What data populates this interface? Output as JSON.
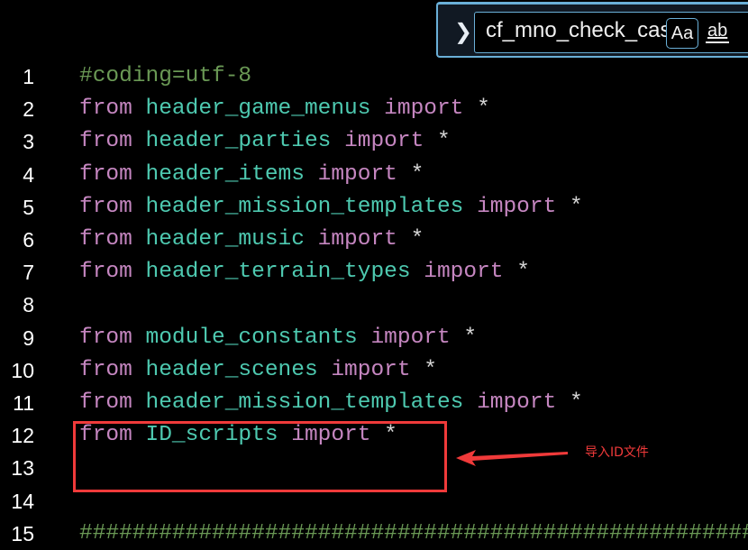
{
  "find_widget": {
    "query": "cf_mno_check_cas",
    "match_case_label": "Aa",
    "whole_word_label": "ab",
    "expand_icon": "chevron-right-icon"
  },
  "lines": [
    {
      "n": "1",
      "tokens": [
        [
          "cm",
          "#coding=utf-8"
        ]
      ]
    },
    {
      "n": "2",
      "tokens": [
        [
          "kw",
          "from"
        ],
        [
          "op",
          " "
        ],
        [
          "id",
          "header_game_menus"
        ],
        [
          "op",
          " "
        ],
        [
          "kw",
          "import"
        ],
        [
          "op",
          " *"
        ]
      ]
    },
    {
      "n": "3",
      "tokens": [
        [
          "kw",
          "from"
        ],
        [
          "op",
          " "
        ],
        [
          "id",
          "header_parties"
        ],
        [
          "op",
          " "
        ],
        [
          "kw",
          "import"
        ],
        [
          "op",
          " *"
        ]
      ]
    },
    {
      "n": "4",
      "tokens": [
        [
          "kw",
          "from"
        ],
        [
          "op",
          " "
        ],
        [
          "id",
          "header_items"
        ],
        [
          "op",
          " "
        ],
        [
          "kw",
          "import"
        ],
        [
          "op",
          " *"
        ]
      ]
    },
    {
      "n": "5",
      "tokens": [
        [
          "kw",
          "from"
        ],
        [
          "op",
          " "
        ],
        [
          "id",
          "header_mission_templates"
        ],
        [
          "op",
          " "
        ],
        [
          "kw",
          "import"
        ],
        [
          "op",
          " *"
        ]
      ]
    },
    {
      "n": "6",
      "tokens": [
        [
          "kw",
          "from"
        ],
        [
          "op",
          " "
        ],
        [
          "id",
          "header_music"
        ],
        [
          "op",
          " "
        ],
        [
          "kw",
          "import"
        ],
        [
          "op",
          " *"
        ]
      ]
    },
    {
      "n": "7",
      "tokens": [
        [
          "kw",
          "from"
        ],
        [
          "op",
          " "
        ],
        [
          "id",
          "header_terrain_types"
        ],
        [
          "op",
          " "
        ],
        [
          "kw",
          "import"
        ],
        [
          "op",
          " *"
        ]
      ]
    },
    {
      "n": "8",
      "tokens": []
    },
    {
      "n": "9",
      "tokens": [
        [
          "kw",
          "from"
        ],
        [
          "op",
          " "
        ],
        [
          "id",
          "module_constants"
        ],
        [
          "op",
          " "
        ],
        [
          "kw",
          "import"
        ],
        [
          "op",
          " *"
        ]
      ]
    },
    {
      "n": "10",
      "tokens": [
        [
          "kw",
          "from"
        ],
        [
          "op",
          " "
        ],
        [
          "id",
          "header_scenes"
        ],
        [
          "op",
          " "
        ],
        [
          "kw",
          "import"
        ],
        [
          "op",
          " *"
        ]
      ]
    },
    {
      "n": "11",
      "tokens": [
        [
          "kw",
          "from"
        ],
        [
          "op",
          " "
        ],
        [
          "id",
          "header_mission_templates"
        ],
        [
          "op",
          " "
        ],
        [
          "kw",
          "import"
        ],
        [
          "op",
          " *"
        ]
      ]
    },
    {
      "n": "12",
      "tokens": [
        [
          "kw",
          "from"
        ],
        [
          "op",
          " "
        ],
        [
          "id",
          "ID_scripts"
        ],
        [
          "op",
          " "
        ],
        [
          "kw",
          "import"
        ],
        [
          "op",
          " *"
        ]
      ]
    },
    {
      "n": "13",
      "tokens": []
    },
    {
      "n": "14",
      "tokens": []
    },
    {
      "n": "15",
      "tokens": [
        [
          "cm",
          "####################################################"
        ]
      ]
    }
  ],
  "annotation": {
    "text": "导入ID文件",
    "color": "#f03a3a"
  },
  "colors": {
    "keyword": "#c586c0",
    "identifier": "#4ec9b0",
    "comment": "#6a9955",
    "background": "#000000"
  }
}
